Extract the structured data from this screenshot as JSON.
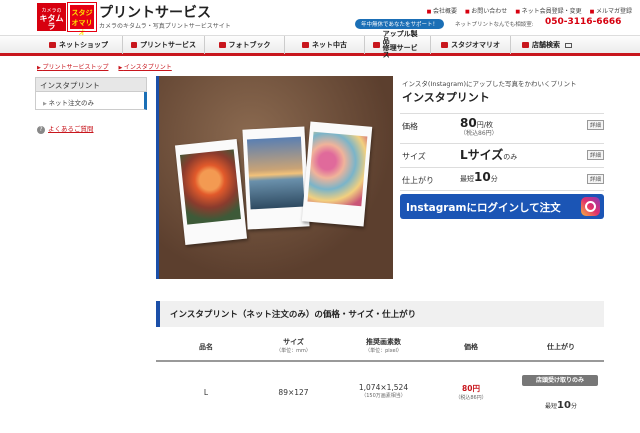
{
  "header": {
    "logo_top": "カメラの",
    "logo_bottom": "キタムラ",
    "studio_logo": "スタジオマリオ",
    "title": "プリントサービス",
    "subtitle": "カメラのキタムラ・写真プリントサービスサイト",
    "top_links": [
      "会社概要",
      "お問い合わせ",
      "ネット会員登録・変更",
      "メルマガ登録"
    ],
    "support_badge": "年中無休であなたをサポート！",
    "support_text": "ネットプリントなんでも相談室:",
    "phone": "050-3116-6666"
  },
  "nav": {
    "items": [
      {
        "label": "ネットショップ"
      },
      {
        "label": "プリントサービス"
      },
      {
        "label": "フォトブック"
      },
      {
        "label": "ネット中古"
      },
      {
        "label": "アップル製品\n修理サービス"
      },
      {
        "label": "スタジオマリオ"
      },
      {
        "label": "店舗検索"
      }
    ]
  },
  "breadcrumb": [
    "プリントサービストップ",
    "インスタプリント"
  ],
  "sidebar": {
    "heading": "インスタプリント",
    "item": "ネット注文のみ",
    "faq": "よくあるご質問"
  },
  "product": {
    "caption": "インスタ(Instagram)にアップした写真をかわいくプリント",
    "title": "インスタプリント",
    "price_label": "価格",
    "price_value": "80",
    "price_unit": "円/枚",
    "price_tax": "（税込86円）",
    "size_label": "サイズ",
    "size_value": "Lサイズ",
    "size_suffix": "のみ",
    "finish_label": "仕上がり",
    "finish_prefix": "最短",
    "finish_value": "10",
    "finish_unit": "分",
    "detail_badge": "詳細",
    "instagram_button": "Instagramにログインして注文"
  },
  "table": {
    "section_title": "インスタプリント（ネット注文のみ）の価格・サイズ・仕上がり",
    "headers": [
      {
        "label": "品名",
        "sub": ""
      },
      {
        "label": "サイズ",
        "sub": "（単位：mm）"
      },
      {
        "label": "推奨画素数",
        "sub": "（単位：pixel）"
      },
      {
        "label": "価格",
        "sub": ""
      },
      {
        "label": "仕上がり",
        "sub": ""
      }
    ],
    "row": {
      "name": "L",
      "size": "89×127",
      "pixels": "1,074×1,524",
      "pixels_sub": "（150万画素相当）",
      "price": "80円",
      "price_tax": "（税込86円）",
      "pickup": "店頭受け取りのみ",
      "finish_prefix": "最短",
      "finish_value": "10",
      "finish_unit": "分"
    }
  }
}
